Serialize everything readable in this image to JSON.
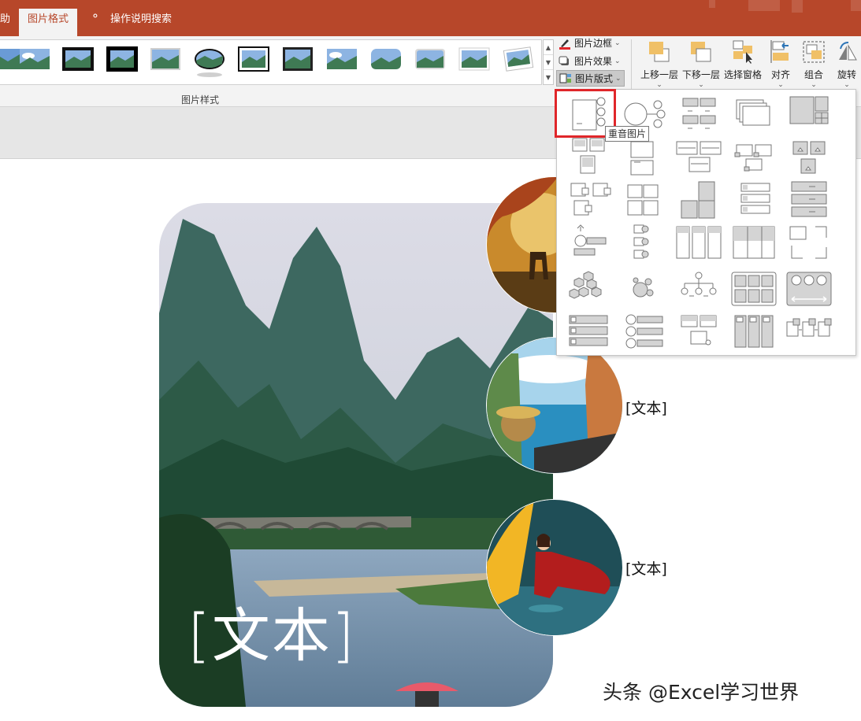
{
  "tabs": {
    "left_partial": "助",
    "active": "图片格式",
    "tell_me": "操作说明搜索"
  },
  "ribbon": {
    "group_label": "图片样式",
    "picture_border": "图片边框",
    "picture_effects": "图片效果",
    "picture_layout": "图片版式",
    "bring_forward": "上移一层",
    "send_backward": "下移一层",
    "selection_pane": "选择窗格",
    "align": "对齐",
    "group": "组合",
    "rotate": "旋转"
  },
  "dropdown": {
    "tooltip": "重音图片",
    "rows": 6,
    "cols": 5
  },
  "slide": {
    "main_text": "[文本]",
    "side_text_1": "[文本]",
    "side_text_2": "[文本]"
  },
  "watermark": "头条 @Excel学习世界",
  "colors": {
    "ribbon_accent": "#b7472a",
    "selection_box": "#e0262a"
  }
}
